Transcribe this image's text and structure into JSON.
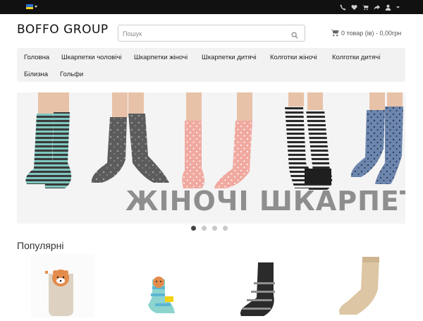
{
  "topbar": {
    "language_icon": "ukraine-flag-icon",
    "icons": [
      "phone-icon",
      "heart-icon",
      "cart-icon",
      "share-icon",
      "user-icon"
    ]
  },
  "header": {
    "logo": "BOFFO GROUP",
    "search_placeholder": "Пошук",
    "cart_label": "0 товар (ів) - 0,00грн"
  },
  "nav": {
    "items": [
      "Головна",
      "Шкарпетки чоловічі",
      "Шкарпетки жіночі",
      "Шкарпетки дитячі",
      "Колготки жіночі",
      "Колготки дитячі",
      "Білизна",
      "Гольфи"
    ]
  },
  "banner": {
    "caption": "ЖІНОЧІ ШКАРПЕТКИ",
    "slides": 4,
    "active_slide": 1
  },
  "popular": {
    "title": "Популярні"
  },
  "colors": {
    "topbar": "#111111",
    "nav_bg": "#f2f2f2",
    "banner_text": "#8e8e8e"
  }
}
